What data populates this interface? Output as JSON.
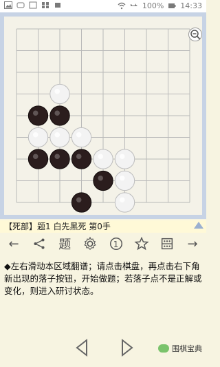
{
  "statusbar": {
    "battery_percent": "100%",
    "time": "14:33"
  },
  "board": {
    "size": 9,
    "stones": {
      "white": [
        [
          2,
          3
        ],
        [
          1,
          5
        ],
        [
          2,
          5
        ],
        [
          3,
          5
        ],
        [
          4,
          6
        ],
        [
          5,
          6
        ],
        [
          5,
          7
        ],
        [
          5,
          8
        ]
      ],
      "black": [
        [
          1,
          4
        ],
        [
          2,
          4
        ],
        [
          1,
          6
        ],
        [
          2,
          6
        ],
        [
          3,
          6
        ],
        [
          4,
          7
        ],
        [
          3,
          8
        ]
      ]
    }
  },
  "problem_info": {
    "text": "【死部】题1 白先黑死 第0手"
  },
  "toolbar": {
    "back_label": "←",
    "forward_label": "→",
    "ti_label": "题",
    "circle_label": "1"
  },
  "message": {
    "text": "◆左右滑动本区域翻谱；请点击棋盘，再点击右下角新出现的落子按钮，开始做题；若落子点不是正解或变化，则进入研讨状态。"
  },
  "brand": {
    "text": "围棋宝典"
  }
}
